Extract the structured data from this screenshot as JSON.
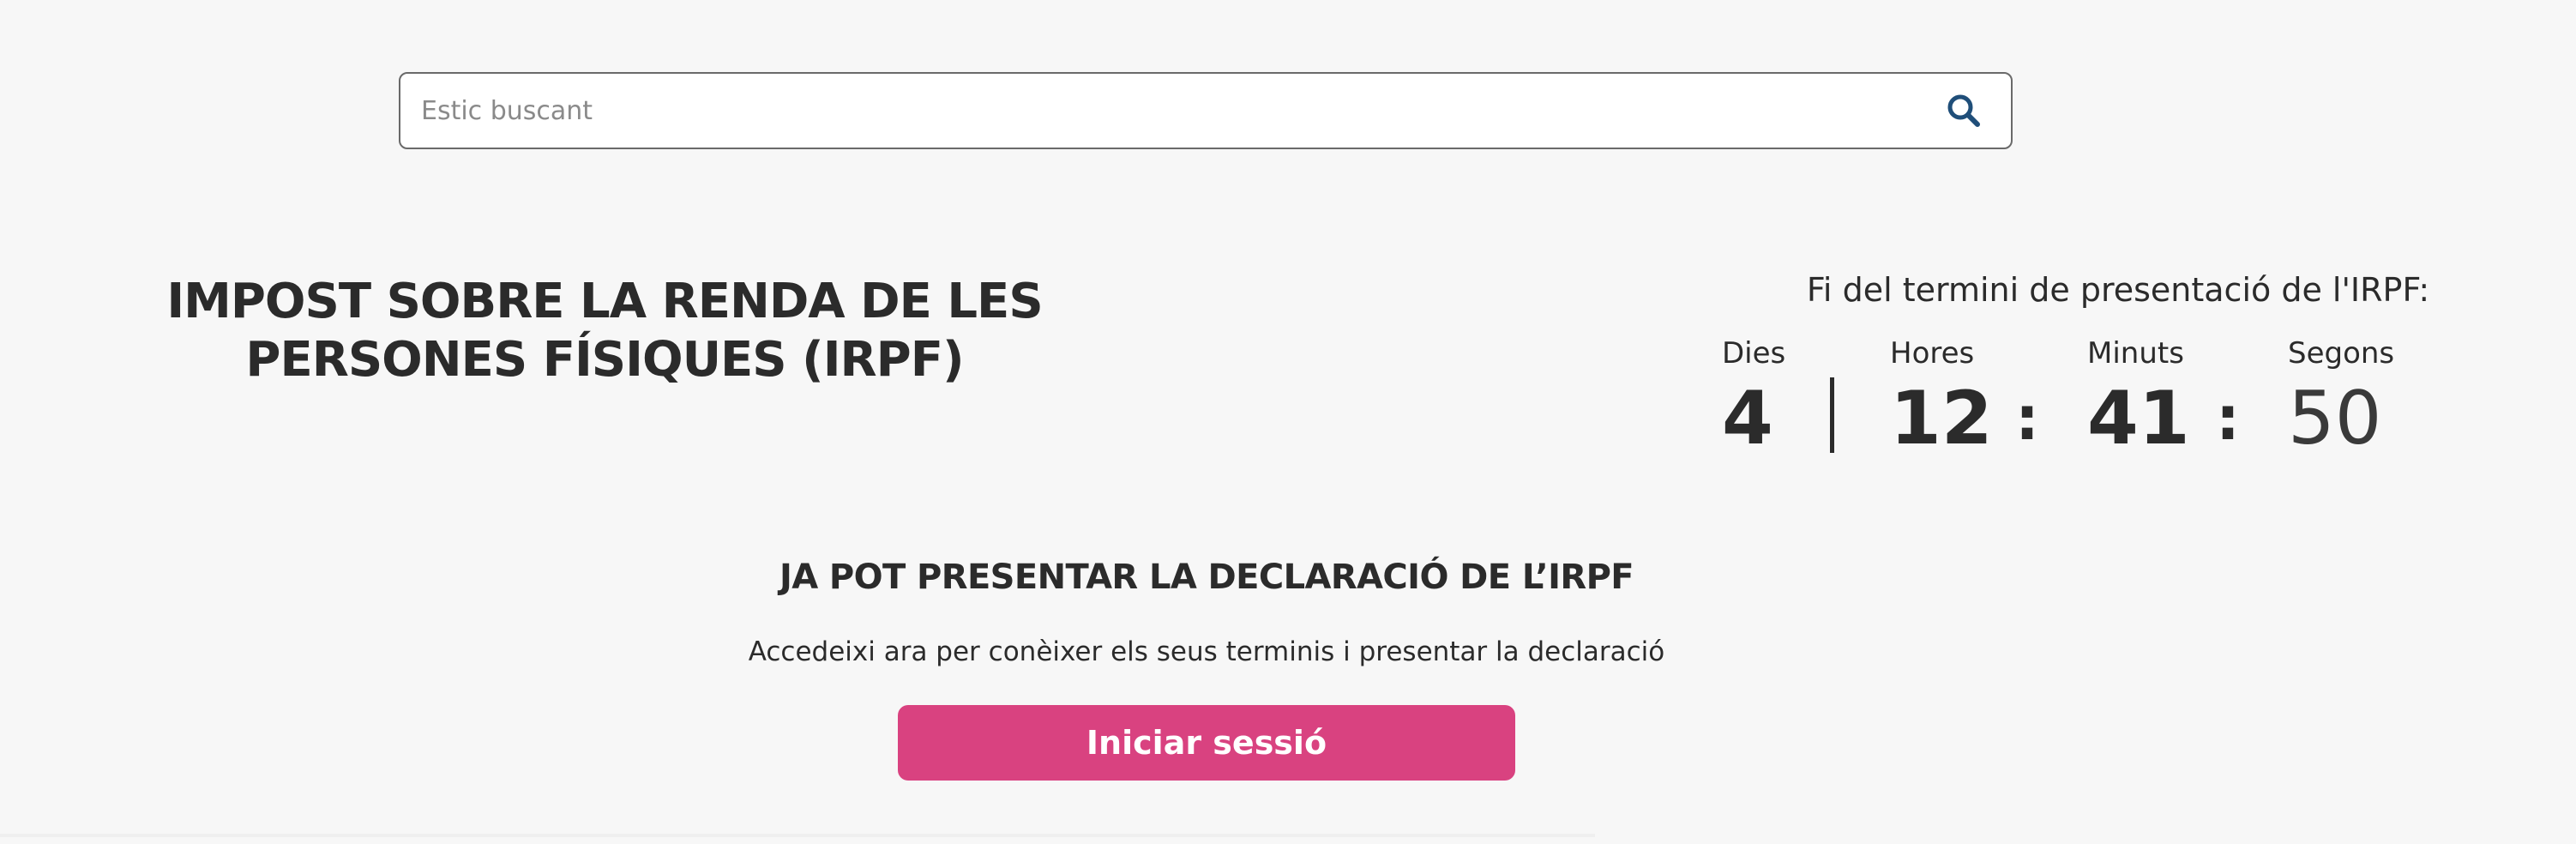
{
  "search": {
    "placeholder": "Estic buscant",
    "icon": "search-icon",
    "icon_color": "#1f4e79"
  },
  "page_title": "IMPOST SOBRE LA RENDA DE LES PERSONES FÍSIQUES (IRPF)",
  "countdown": {
    "label": "Fi del termini de presentació de l'IRPF:",
    "days_label": "Dies",
    "days_value": "4",
    "hours_label": "Hores",
    "hours_value": "12",
    "minutes_label": "Minuts",
    "minutes_value": "41",
    "seconds_label": "Segons",
    "seconds_value": "50"
  },
  "cta": {
    "heading": "JA POT PRESENTAR LA DECLARACIÓ DE L’IRPF",
    "text": "Accedeixi ara per conèixer els seus terminis i presentar la declaració",
    "button_label": "Iniciar sessió",
    "button_color": "#d94280"
  },
  "colors": {
    "background": "#f7f7f7",
    "text": "#2b2b2b"
  }
}
